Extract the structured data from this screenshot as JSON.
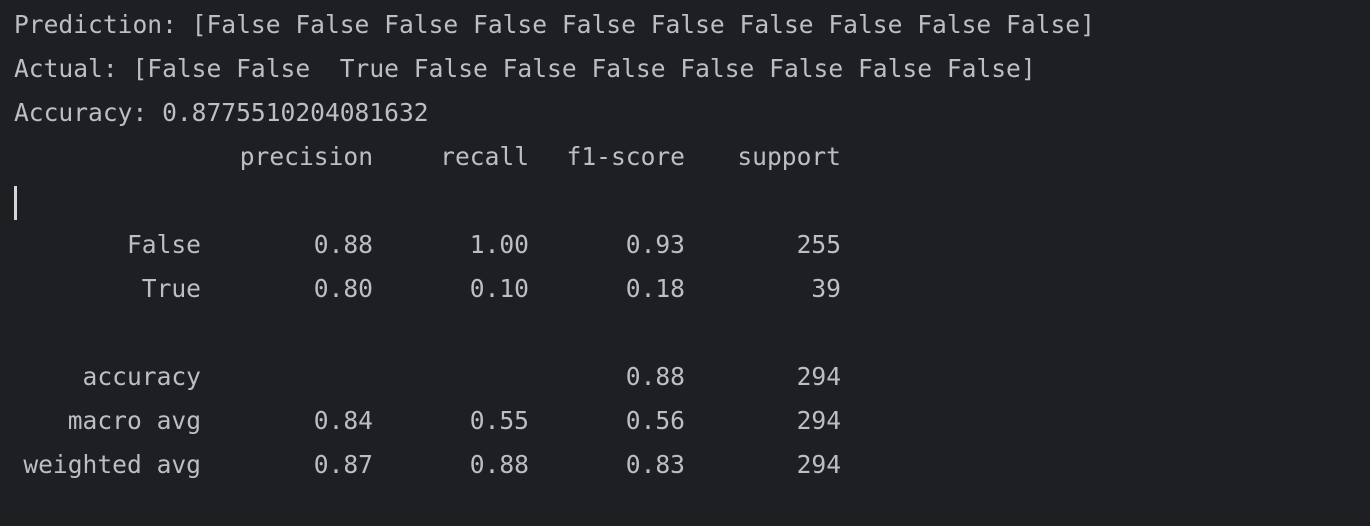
{
  "output": {
    "prediction_line": "Prediction: [False False False False False False False False False False]",
    "actual_line": "Actual: [False False  True False False False False False False False]",
    "accuracy_line": "Accuracy: 0.8775510204081632"
  },
  "report": {
    "headers": {
      "precision": "precision",
      "recall": "recall",
      "f1": "f1-score",
      "support": "support"
    },
    "rows": [
      {
        "label": "False",
        "precision": "0.88",
        "recall": "1.00",
        "f1": "0.93",
        "support": "255"
      },
      {
        "label": "True",
        "precision": "0.80",
        "recall": "0.10",
        "f1": "0.18",
        "support": "39"
      },
      {
        "label": "accuracy",
        "precision": "",
        "recall": "",
        "f1": "0.88",
        "support": "294"
      },
      {
        "label": "macro avg",
        "precision": "0.84",
        "recall": "0.55",
        "f1": "0.56",
        "support": "294"
      },
      {
        "label": "weighted avg",
        "precision": "0.87",
        "recall": "0.88",
        "f1": "0.83",
        "support": "294"
      }
    ]
  },
  "colors": {
    "background": "#1e1f22",
    "text": "#bcbec4"
  }
}
